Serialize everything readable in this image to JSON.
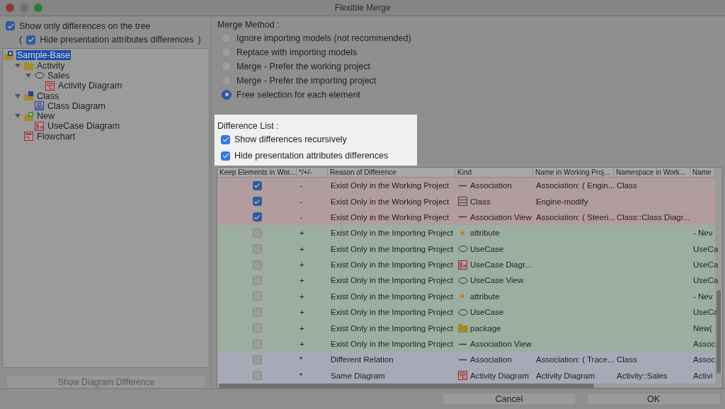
{
  "window": {
    "title": "Flexible Merge"
  },
  "left": {
    "show_only": {
      "label": "Show only differences on the tree",
      "checked": true
    },
    "hide_presentation": {
      "open": "(",
      "label": "Hide presentation attributes differences",
      "checked": true,
      "close": ")"
    },
    "tree": [
      {
        "label": "Sample-Base",
        "kind": "model",
        "selected": true,
        "children": [
          {
            "label": "Activity",
            "kind": "folder",
            "selected": false,
            "expanded": true,
            "children": [
              {
                "label": "Sales",
                "kind": "usecase",
                "selected": false,
                "expanded": true,
                "children": [
                  {
                    "label": "Activity Diagram",
                    "kind": "activity-diagram",
                    "selected": false
                  }
                ]
              }
            ]
          },
          {
            "label": "Class",
            "kind": "folder-model",
            "selected": false,
            "expanded": true,
            "children": [
              {
                "label": "Class Diagram",
                "kind": "class-diagram",
                "selected": false
              }
            ]
          },
          {
            "label": "New",
            "kind": "folder-new",
            "selected": false,
            "expanded": true,
            "children": [
              {
                "label": "UseCase Diagram",
                "kind": "usecase-diagram",
                "selected": false
              }
            ]
          },
          {
            "label": "Flowchart",
            "kind": "flowchart",
            "selected": false
          }
        ]
      }
    ],
    "button": "Show Diagram Difference"
  },
  "merge_method": {
    "title": "Merge Method :",
    "options": [
      {
        "label": "Ignore importing models (not recommended)",
        "selected": false
      },
      {
        "label": "Replace with importing models",
        "selected": false
      },
      {
        "label": "Merge - Prefer the working project",
        "selected": false
      },
      {
        "label": "Merge - Prefer the importing project",
        "selected": false
      },
      {
        "label": "Free selection for each element",
        "selected": true
      }
    ]
  },
  "difference_list": {
    "title": "Difference List :",
    "options": [
      {
        "label": "Show differences recursively",
        "checked": true
      },
      {
        "label": "Hide presentation attributes differences",
        "checked": true
      }
    ]
  },
  "table": {
    "columns": [
      "Keep Elements in Wor...",
      "*/+/-",
      "Reason of Difference",
      "Kind",
      "Name in Working Proj...",
      "Namespace in Work...",
      "Name"
    ],
    "rows": [
      {
        "color": "#b19c9e",
        "keep": true,
        "sign": "-",
        "reason": "Exist Only in the Working Project",
        "kind": "line",
        "element_kind": "Association",
        "name_working": "Association: ( Engin...",
        "namespace_working": "Class"
      },
      {
        "color": "#b19c9e",
        "keep": true,
        "sign": "-",
        "reason": "Exist Only in the Working Project",
        "kind": "class",
        "element_kind": "Class",
        "name_working": "Engine-modify"
      },
      {
        "color": "#b19c9e",
        "keep": true,
        "sign": "-",
        "reason": "Exist Only in the Working Project",
        "kind": "line",
        "element_kind": "Association View",
        "name_working": "Association: ( Steeri...",
        "namespace_working": "Class::Class Diagr..."
      },
      {
        "color": "#9cae9f",
        "keep": false,
        "sign": "+",
        "reason": "Exist Only in the Importing Project",
        "kind": "attribute",
        "element_kind": "attribute",
        "name": "- Nev"
      },
      {
        "color": "#9cae9f",
        "keep": false,
        "sign": "+",
        "reason": "Exist Only in the Importing Project",
        "kind": "usecase",
        "element_kind": "UseCase",
        "name": "UseCa"
      },
      {
        "color": "#9cae9f",
        "keep": false,
        "sign": "+",
        "reason": "Exist Only in the Importing Project",
        "kind": "usecase-diagram",
        "element_kind": "UseCase Diagr...",
        "name": "UseCa"
      },
      {
        "color": "#9cae9f",
        "keep": false,
        "sign": "+",
        "reason": "Exist Only in the Importing Project",
        "kind": "usecase",
        "element_kind": "UseCase View",
        "name": "UseCa"
      },
      {
        "color": "#9cae9f",
        "keep": false,
        "sign": "+",
        "reason": "Exist Only in the Importing Project",
        "kind": "attribute",
        "element_kind": "attribute",
        "name": "- Nev"
      },
      {
        "color": "#9cae9f",
        "keep": false,
        "sign": "+",
        "reason": "Exist Only in the Importing Project",
        "kind": "usecase",
        "element_kind": "UseCase",
        "name": "UseCa"
      },
      {
        "color": "#9cae9f",
        "keep": false,
        "sign": "+",
        "reason": "Exist Only in the Importing Project",
        "kind": "package",
        "element_kind": "package",
        "name": "New("
      },
      {
        "color": "#9cae9f",
        "keep": false,
        "sign": "+",
        "reason": "Exist Only in the Importing Project",
        "kind": "line",
        "element_kind": "Association View",
        "name": "Assoc"
      },
      {
        "color": "#a6a9b6",
        "keep": false,
        "sign": "*",
        "reason": "Different Relation",
        "kind": "line",
        "element_kind": "Association",
        "name_working": "Association: ( Trace...",
        "namespace_working": "Class",
        "name": "Assoc"
      },
      {
        "color": "#a6a9b6",
        "keep": false,
        "sign": "*",
        "reason": "Same Diagram",
        "kind": "activity-diagram",
        "element_kind": "Activity Diagram",
        "name_working": "Activity Diagram",
        "namespace_working": "Activity::Sales",
        "name": "Activi"
      }
    ]
  },
  "buttons": [
    "Cancel",
    "OK"
  ]
}
